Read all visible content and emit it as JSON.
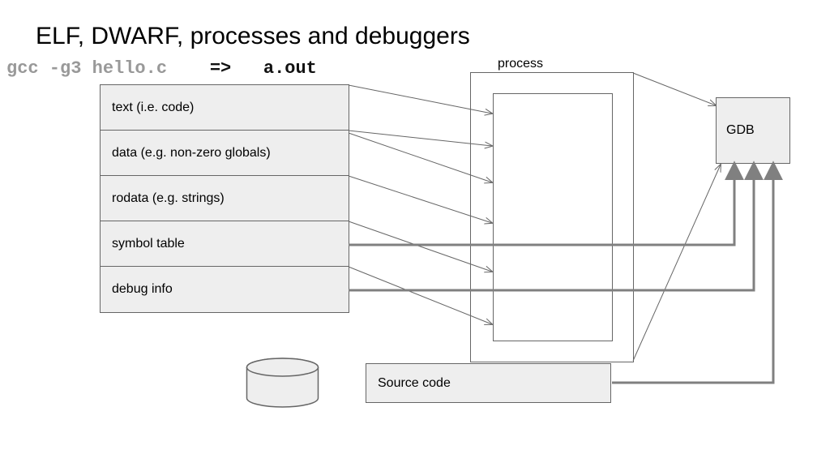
{
  "title": "ELF, DWARF, processes and debuggers",
  "command": {
    "grey": "gcc -g3 hello.c",
    "arrow": "=>",
    "out": "a.out"
  },
  "sections": {
    "s0": "text (i.e. code)",
    "s1": "data (e.g. non-zero globals)",
    "s2": "rodata (e.g. strings)",
    "s3": "symbol table",
    "s4": "debug info"
  },
  "process_label": "process",
  "gdb_label": "GDB",
  "source_label": "Source code",
  "colors": {
    "stroke_thin": "#666666",
    "stroke_thick": "#808080",
    "box_fill": "#eeeeee"
  }
}
